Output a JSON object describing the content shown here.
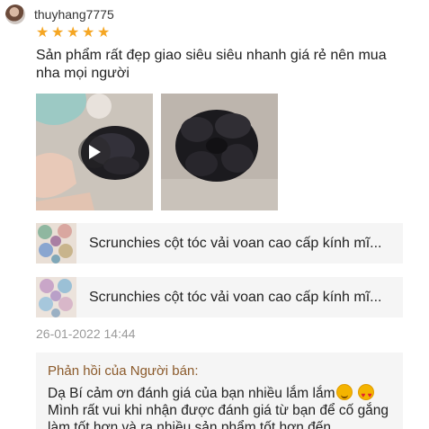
{
  "review": {
    "username": "thuyhang7775",
    "rating": 5,
    "stars": [
      "★",
      "★",
      "★",
      "★",
      "★"
    ],
    "text": "Sản phẩm rất đẹp giao siêu siêu nhanh giá rẻ nên mua nha mọi người",
    "date": "26-01-2022 14:44"
  },
  "media": [
    {
      "type": "video",
      "icon": "play-icon"
    },
    {
      "type": "image"
    }
  ],
  "products": [
    {
      "name": "Scrunchies cột tóc vải voan cao cấp kính mĩ..."
    },
    {
      "name": "Scrunchies cột tóc vải voan cao cấp kính mĩ..."
    }
  ],
  "seller_reply": {
    "title": "Phản hồi của Người bán:",
    "line1": "Dạ Bí cảm ơn đánh giá của bạn nhiều lắm lắm",
    "line2": "Mình rất vui khi nhận được đánh giá từ bạn để cố gắng làm tốt hơn và ra nhiều sản phẩm tốt hơn đến"
  },
  "colors": {
    "star": "#f5a623",
    "reply_title": "#8b5a2b",
    "date": "#9a9a9a",
    "card_bg": "#f5f5f5"
  }
}
